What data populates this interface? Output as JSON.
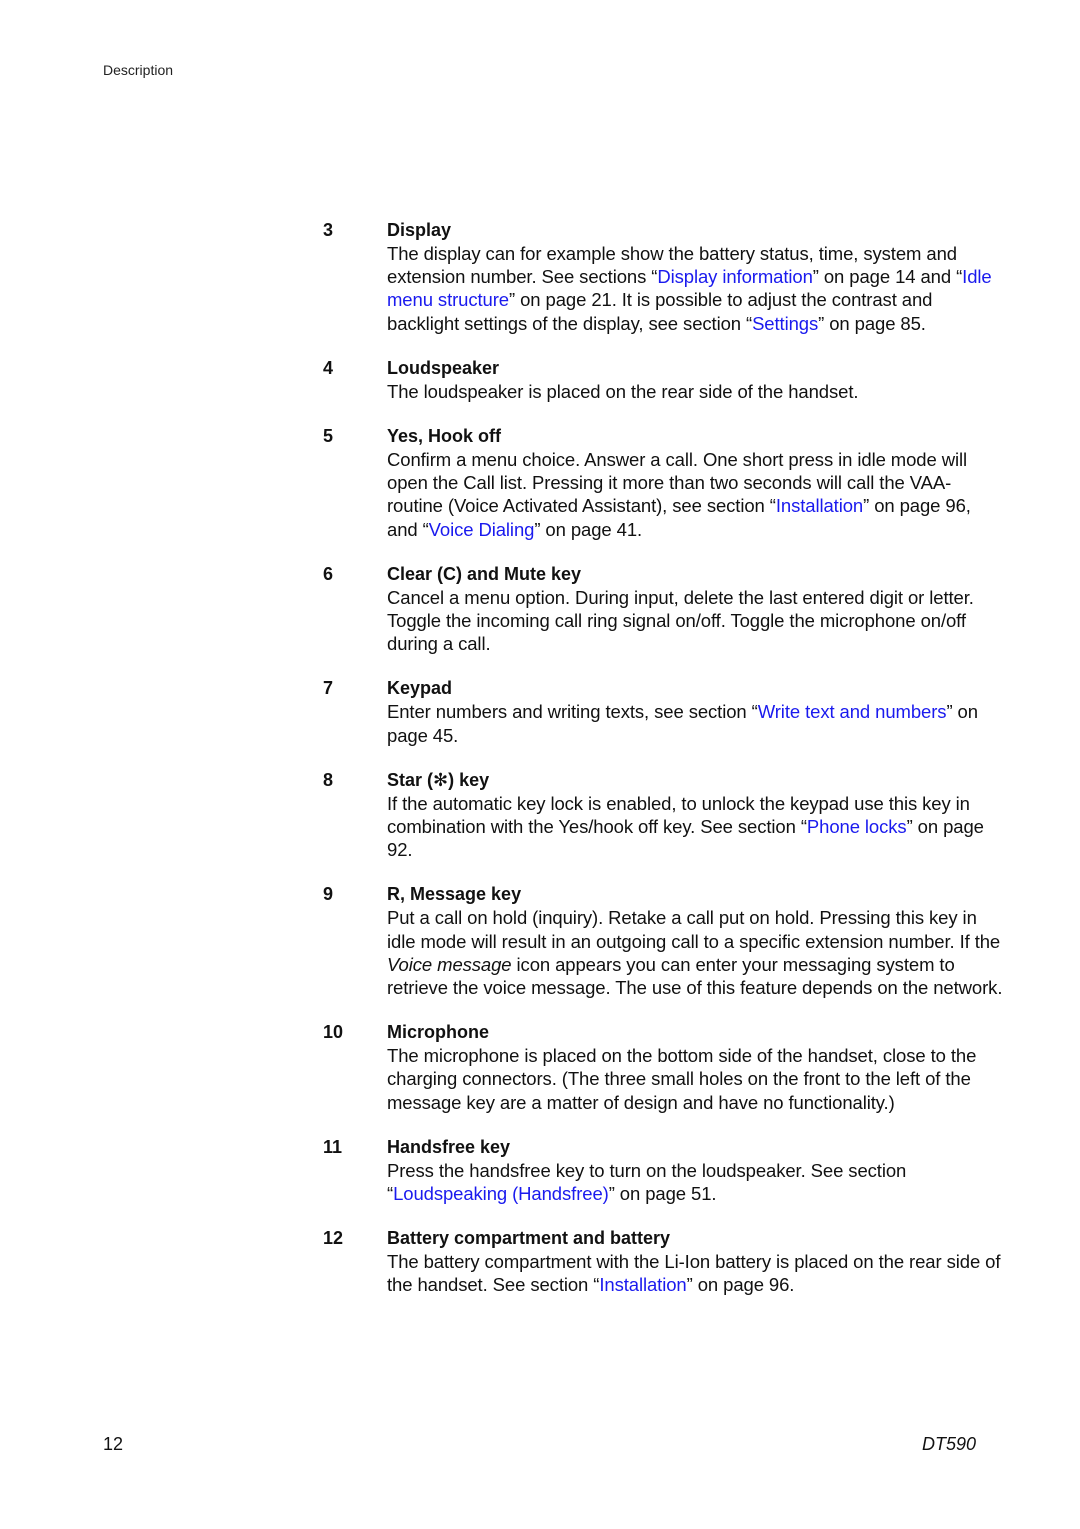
{
  "header": {
    "running_head": "Description"
  },
  "link_color": "#1a1aee",
  "items": [
    {
      "num": "3",
      "title": "Display",
      "segments": [
        {
          "t": "The display can for example show the battery status, time, system and extension number. See sections “"
        },
        {
          "t": "Display information",
          "link": true
        },
        {
          "t": "” on page 14 and “"
        },
        {
          "t": "Idle menu structure",
          "link": true
        },
        {
          "t": "” on page 21. It is possible to adjust the contrast and backlight settings of the display, see section “"
        },
        {
          "t": "Settings",
          "link": true
        },
        {
          "t": "” on page 85."
        }
      ]
    },
    {
      "num": "4",
      "title": "Loudspeaker",
      "segments": [
        {
          "t": "The loudspeaker is placed on the rear side of the handset."
        }
      ]
    },
    {
      "num": "5",
      "title": "Yes, Hook off",
      "segments": [
        {
          "t": "Confirm a menu choice. Answer a call. One short press in idle mode will open the Call list. Pressing it more than two seconds will call the VAA-routine (Voice Activated Assistant), see section “"
        },
        {
          "t": "Installation",
          "link": true
        },
        {
          "t": "” on page 96, and “"
        },
        {
          "t": "Voice Dialing",
          "link": true
        },
        {
          "t": "” on page 41."
        }
      ]
    },
    {
      "num": "6",
      "title": "Clear (C) and Mute key",
      "segments": [
        {
          "t": "Cancel a menu option. During input, delete the last entered digit or letter. Toggle the incoming call ring signal on/off. Toggle the microphone on/off during a call."
        }
      ]
    },
    {
      "num": "7",
      "title": "Keypad",
      "segments": [
        {
          "t": "Enter numbers and writing texts, see section “"
        },
        {
          "t": "Write text and numbers",
          "link": true
        },
        {
          "t": "” on page 45."
        }
      ]
    },
    {
      "num": "8",
      "title": "Star (✻) key",
      "segments": [
        {
          "t": "If the automatic key lock is enabled, to unlock the keypad use this key in combination with the Yes/hook off key. See section “"
        },
        {
          "t": "Phone locks",
          "link": true
        },
        {
          "t": "” on page 92."
        }
      ]
    },
    {
      "num": "9",
      "title": "R, Message key",
      "segments": [
        {
          "t": "Put a call on hold (inquiry). Retake a call put on hold. Pressing this key in idle mode will result in an outgoing call to a specific extension number. If the "
        },
        {
          "t": "Voice message",
          "italic": true
        },
        {
          "t": " icon appears you can enter your messaging system to retrieve the voice message. The use of this feature depends on the network."
        }
      ]
    },
    {
      "num": "10",
      "title": "Microphone",
      "segments": [
        {
          "t": "The microphone is placed on the bottom side of the handset, close to the charging connectors. (The three small holes on the front to the left of the message key are a matter of design and have no functionality.)"
        }
      ]
    },
    {
      "num": "11",
      "title": "Handsfree key",
      "segments": [
        {
          "t": "Press the handsfree key to turn on the loudspeaker. See section “"
        },
        {
          "t": "Loudspeaking (Handsfree)",
          "link": true
        },
        {
          "t": "” on page 51."
        }
      ]
    },
    {
      "num": "12",
      "title": "Battery compartment and battery",
      "segments": [
        {
          "t": "The battery compartment with the Li-Ion battery is placed on the rear side of the handset. See section “"
        },
        {
          "t": "Installation",
          "link": true
        },
        {
          "t": "” on page 96."
        }
      ]
    }
  ],
  "footer": {
    "page_number": "12",
    "doc_title": "DT590"
  }
}
